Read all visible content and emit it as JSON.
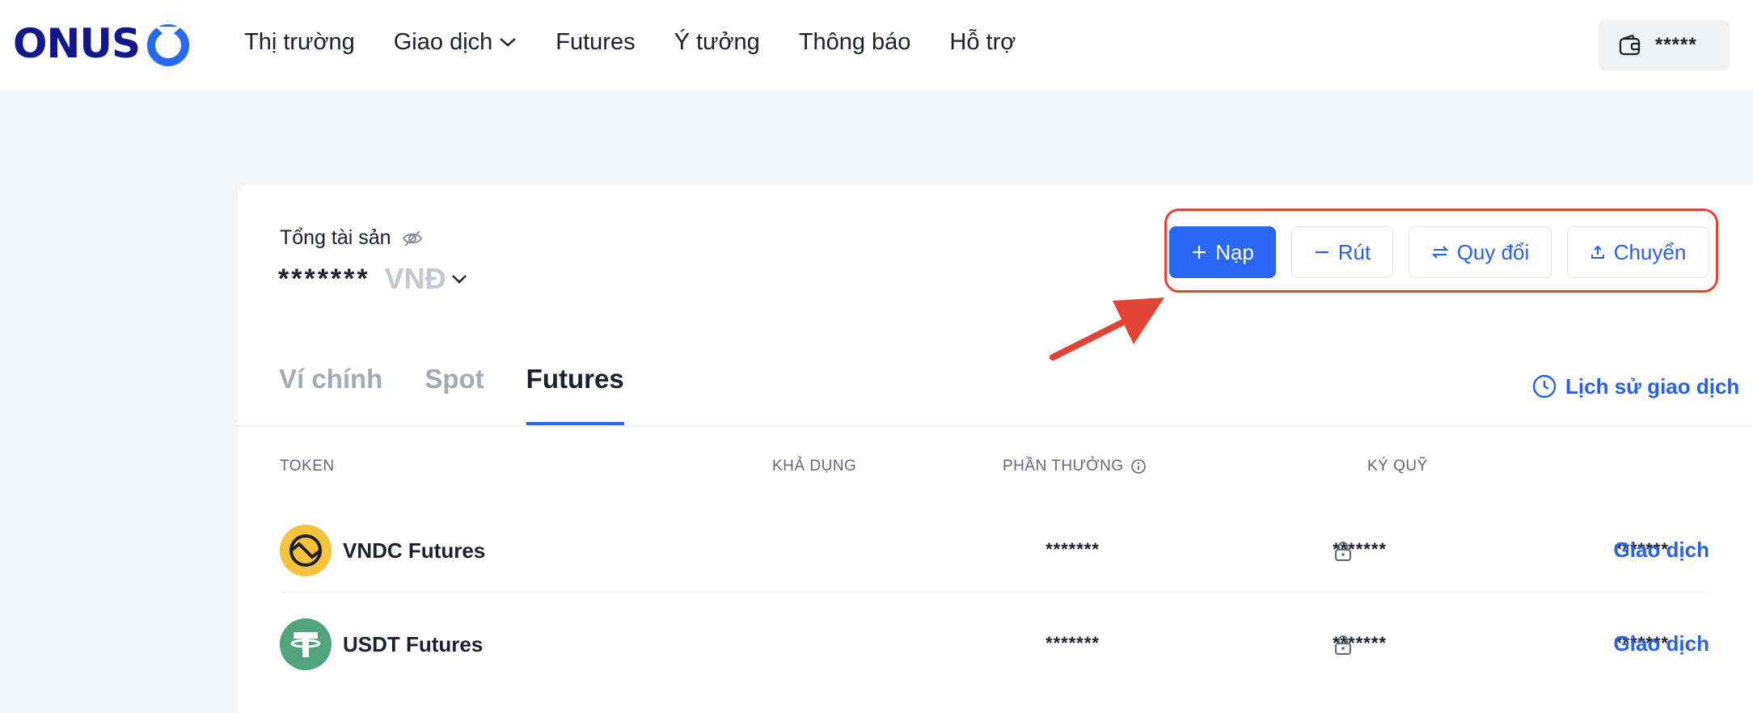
{
  "header": {
    "logo_text": "ONUS",
    "nav": [
      {
        "label": "Thị trường"
      },
      {
        "label": "Giao dịch",
        "has_dropdown": true
      },
      {
        "label": "Futures"
      },
      {
        "label": "Ý tưởng"
      },
      {
        "label": "Thông báo"
      },
      {
        "label": "Hỗ trợ"
      }
    ],
    "wallet": {
      "icon": "wallet-icon",
      "masked_balance": "*****"
    }
  },
  "summary": {
    "total_label": "Tổng tài sản",
    "visibility_icon": "eye-off-icon",
    "masked_value": "*******",
    "currency": "VNĐ"
  },
  "actions": [
    {
      "label": "Nạp",
      "icon": "plus-icon",
      "primary": true
    },
    {
      "label": "Rút",
      "icon": "minus-icon",
      "primary": false
    },
    {
      "label": "Quy đổi",
      "icon": "swap-icon",
      "primary": false
    },
    {
      "label": "Chuyển",
      "icon": "transfer-icon",
      "primary": false
    }
  ],
  "tabs": [
    {
      "label": "Ví chính",
      "active": false
    },
    {
      "label": "Spot",
      "active": false
    },
    {
      "label": "Futures",
      "active": true
    }
  ],
  "history_link": {
    "label": "Lịch sử giao dịch",
    "icon": "clock-icon"
  },
  "table": {
    "columns": [
      "TOKEN",
      "KHẢ DỤNG",
      "PHẦN THƯỞNG",
      "KÝ QUỸ"
    ],
    "rows": [
      {
        "token": "VNDC Futures",
        "icon": "vndc-icon",
        "available": "*******",
        "reward": "*******",
        "margin": "*******",
        "action": "Giao dịch"
      },
      {
        "token": "USDT Futures",
        "icon": "usdt-icon",
        "available": "*******",
        "reward": "*******",
        "margin": "*******",
        "action": "Giao dịch"
      }
    ]
  },
  "colors": {
    "brand": "#13178d",
    "accent": "#2966f2",
    "highlight": "#e44435",
    "vndc": "#f5c33b",
    "usdt": "#50a37b"
  }
}
